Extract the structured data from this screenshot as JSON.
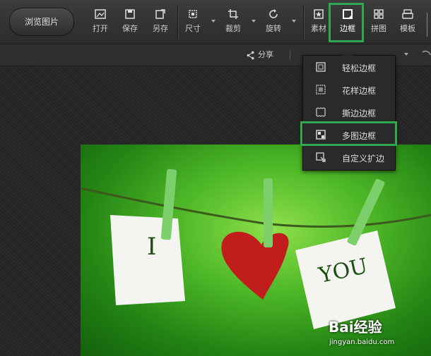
{
  "toolbar": {
    "browse_label": "浏览图片",
    "tools": [
      {
        "label": "打开",
        "icon": "image-open-icon"
      },
      {
        "label": "保存",
        "icon": "save-icon"
      },
      {
        "label": "另存",
        "icon": "save-as-icon"
      },
      {
        "label": "尺寸",
        "icon": "resize-icon"
      },
      {
        "label": "裁剪",
        "icon": "crop-icon"
      },
      {
        "label": "旋转",
        "icon": "rotate-icon"
      },
      {
        "label": "素材",
        "icon": "sticker-icon"
      },
      {
        "label": "边框",
        "icon": "frame-icon"
      },
      {
        "label": "拼图",
        "icon": "collage-icon"
      },
      {
        "label": "模板",
        "icon": "template-icon"
      }
    ]
  },
  "subbar": {
    "share_label": "分享"
  },
  "frame_menu": {
    "items": [
      {
        "label": "轻松边框"
      },
      {
        "label": "花样边框"
      },
      {
        "label": "撕边边框"
      },
      {
        "label": "多图边框"
      },
      {
        "label": "自定义扩边"
      }
    ]
  },
  "photo": {
    "note_left": "I",
    "note_right": "YOU"
  },
  "watermark": {
    "brand": "Bai经验",
    "url": "jingyan.baidu.com"
  },
  "colors": {
    "highlight": "#2fa84f",
    "toolbar_bg": "#333333"
  }
}
